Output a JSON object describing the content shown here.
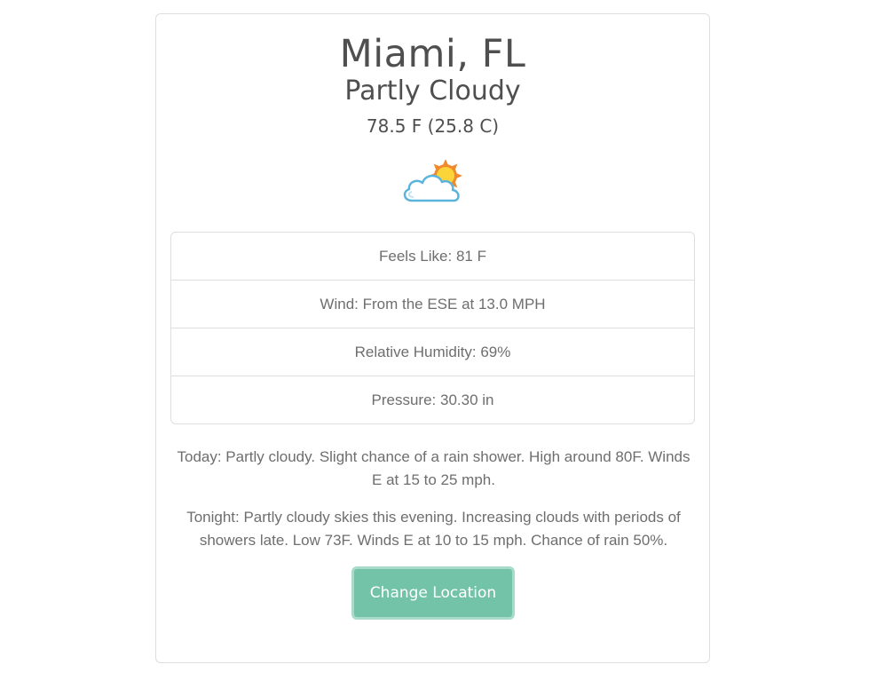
{
  "location": {
    "city": "Miami, FL"
  },
  "current": {
    "condition": "Partly Cloudy",
    "temperature": "78.5 F (25.8 C)",
    "icon": "partly-cloudy-icon"
  },
  "details": [
    {
      "label": "Feels Like: 81 F"
    },
    {
      "label": "Wind: From the ESE at 13.0 MPH"
    },
    {
      "label": "Relative Humidity: 69%"
    },
    {
      "label": "Pressure: 30.30 in"
    }
  ],
  "forecast": {
    "today": "Today: Partly cloudy. Slight chance of a rain shower. High around 80F. Winds E at 15 to 25 mph.",
    "tonight": "Tonight: Partly cloudy skies this evening. Increasing clouds with periods of showers late. Low 73F. Winds E at 10 to 15 mph. Chance of rain 50%."
  },
  "actions": {
    "change_location_label": "Change Location"
  },
  "colors": {
    "button": "#72c3a8",
    "button_border": "#a8dcc8",
    "text_dark": "#4f4f4f",
    "text_muted": "#6e6e6e",
    "border": "#dedede"
  }
}
